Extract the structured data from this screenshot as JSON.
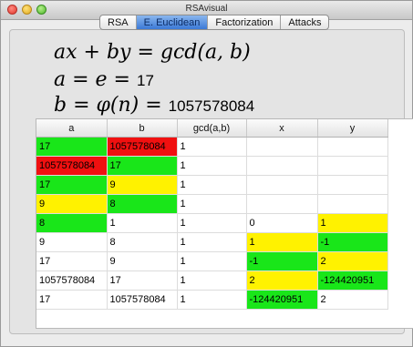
{
  "window": {
    "title": "RSAvisual"
  },
  "tabs": [
    {
      "label": "RSA",
      "active": false
    },
    {
      "label": "E. Euclidean",
      "active": true
    },
    {
      "label": "Factorization",
      "active": false
    },
    {
      "label": "Attacks",
      "active": false
    }
  ],
  "formulas": {
    "line1": "ax + by = gcd(a, b)",
    "line2_prefix": "a = e = ",
    "line2_value": "17",
    "line3_prefix": "b = φ(n) = ",
    "line3_value": "1057578084"
  },
  "table": {
    "columns": [
      "a",
      "b",
      "gcd(a,b)",
      "x",
      "y"
    ],
    "rows": [
      {
        "a": "17",
        "b": "1057578084",
        "gcd": "1",
        "x": "",
        "y": "",
        "colors": {
          "a": "green",
          "b": "red"
        }
      },
      {
        "a": "1057578084",
        "b": "17",
        "gcd": "1",
        "x": "",
        "y": "",
        "colors": {
          "a": "red",
          "b": "green"
        }
      },
      {
        "a": "17",
        "b": "9",
        "gcd": "1",
        "x": "",
        "y": "",
        "colors": {
          "a": "green",
          "b": "yellow"
        }
      },
      {
        "a": "9",
        "b": "8",
        "gcd": "1",
        "x": "",
        "y": "",
        "colors": {
          "a": "yellow",
          "b": "green"
        }
      },
      {
        "a": "8",
        "b": "1",
        "gcd": "1",
        "x": "0",
        "y": "1",
        "colors": {
          "a": "green",
          "y": "yellow"
        }
      },
      {
        "a": "9",
        "b": "8",
        "gcd": "1",
        "x": "1",
        "y": "-1",
        "colors": {
          "x": "yellow",
          "y": "green"
        }
      },
      {
        "a": "17",
        "b": "9",
        "gcd": "1",
        "x": "-1",
        "y": "2",
        "colors": {
          "x": "green",
          "y": "yellow"
        }
      },
      {
        "a": "1057578084",
        "b": "17",
        "gcd": "1",
        "x": "2",
        "y": "-124420951",
        "colors": {
          "x": "yellow",
          "y": "green"
        }
      },
      {
        "a": "17",
        "b": "1057578084",
        "gcd": "1",
        "x": "-124420951",
        "y": "2",
        "colors": {
          "x": "green"
        }
      }
    ]
  },
  "colors": {
    "green": "#19e619",
    "red": "#f01010",
    "yellow": "#fff200",
    "active_tab": "#3b79d6"
  }
}
